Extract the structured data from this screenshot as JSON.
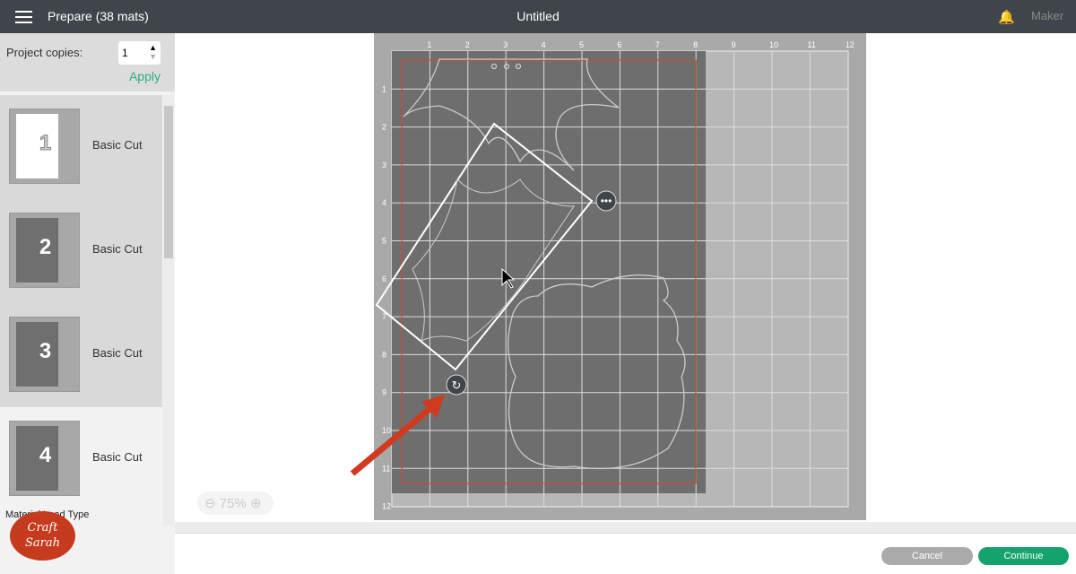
{
  "header": {
    "title": "Prepare (38 mats)",
    "document": "Untitled",
    "machine": "Maker"
  },
  "sidebar": {
    "copies_label": "Project copies:",
    "copies_value": "1",
    "apply": "Apply",
    "mats": [
      {
        "num": "1",
        "label": "Basic Cut"
      },
      {
        "num": "2",
        "label": "Basic Cut"
      },
      {
        "num": "3",
        "label": "Basic Cut"
      },
      {
        "num": "4",
        "label": "Basic Cut"
      }
    ],
    "material_label": "Material Load Type"
  },
  "logo": "Craft with Sarah",
  "canvas": {
    "zoom": "75%",
    "top_ruler": [
      "1",
      "2",
      "3",
      "4",
      "5",
      "6",
      "7",
      "8",
      "9",
      "10",
      "11",
      "12"
    ],
    "left_ruler": [
      "1",
      "2",
      "3",
      "4",
      "5",
      "6",
      "7",
      "8",
      "9",
      "10",
      "11",
      "12"
    ]
  },
  "footer": {
    "cancel": "Cancel",
    "continue": "Continue"
  }
}
